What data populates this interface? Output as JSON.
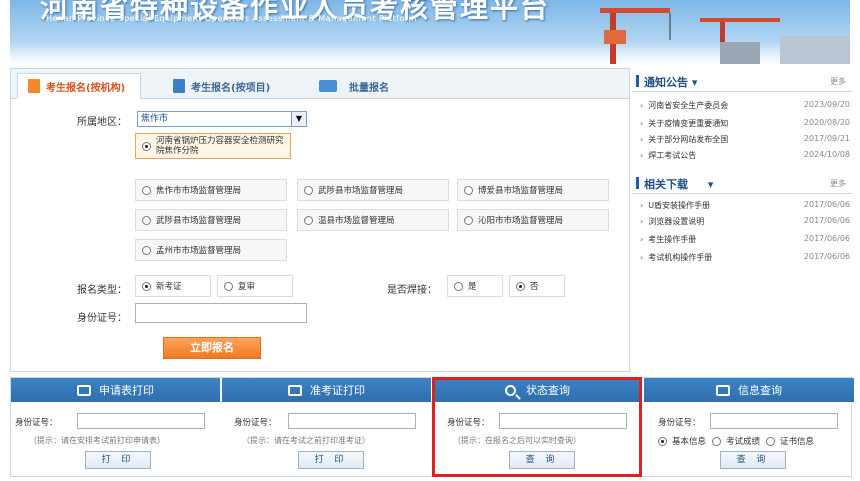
{
  "banner": {
    "title": "河南省特种设备作业人员考核管理平台",
    "subtitle": "Henan Province Special Equipment Operators Assessment & Management Platform"
  },
  "tabs": [
    {
      "label": "考生报名(按机构)",
      "icon": "document-icon"
    },
    {
      "label": "考生报名(按项目)",
      "icon": "document-icon"
    },
    {
      "label": "批量报名",
      "icon": "folder-icon"
    }
  ],
  "form": {
    "region_label": "所属地区：",
    "region_value": "焦作市",
    "selected_org": "河南省锅炉压力容器安全检测研究院焦作分院",
    "orgs": [
      "焦作市市场监督管理局",
      "武陟县市场监督管理局",
      "博爱县市场监督管理局",
      "武陟县市场监督管理局",
      "温县市场监督管理局",
      "沁阳市市场监督管理局",
      "孟州市市场监督管理局"
    ],
    "type_label": "报名类型：",
    "type_new": "新考证",
    "type_renew": "复审",
    "weld_label": "是否焊接：",
    "weld_yes": "是",
    "weld_no": "否",
    "id_label": "身份证号：",
    "submit_label": "立即报名"
  },
  "notice": {
    "title": "通知公告",
    "more": "更多",
    "items": [
      {
        "text": "河南省安全生产委员会",
        "date": "2023/09/20"
      },
      {
        "text": "关于疫情变更重要通知",
        "date": "2020/08/20"
      },
      {
        "text": "关于部分网站发布全国",
        "date": "2017/09/21"
      },
      {
        "text": "焊工考试公告",
        "date": "2024/10/08"
      }
    ]
  },
  "downloads": {
    "title": "相关下载",
    "more": "更多",
    "items": [
      {
        "text": "U盾安装操作手册",
        "date": "2017/06/06"
      },
      {
        "text": "浏览器设置说明",
        "date": "2017/06/06"
      },
      {
        "text": "考生操作手册",
        "date": "2017/06/06"
      },
      {
        "text": "考试机构操作手册",
        "date": "2017/06/06"
      }
    ]
  },
  "bottom": [
    {
      "title": "申请表打印",
      "id_label": "身份证号：",
      "hint": "（提示：请在安排考试前打印申请表）",
      "button": "打 印"
    },
    {
      "title": "准考证打印",
      "id_label": "身份证号：",
      "hint": "（提示：请在考试之前打印准考证）",
      "button": "打 印"
    },
    {
      "title": "状态查询",
      "id_label": "身份证号：",
      "hint": "（提示：在报名之后可以实时查询）",
      "button": "查 询"
    },
    {
      "title": "信息查询",
      "id_label": "身份证号：",
      "button": "查 询",
      "radios": [
        "基本信息",
        "考试成绩",
        "证书信息"
      ]
    }
  ],
  "colors": {
    "accent": "#2f6fae",
    "highlight": "#e02020",
    "submit": "#f07a20"
  }
}
